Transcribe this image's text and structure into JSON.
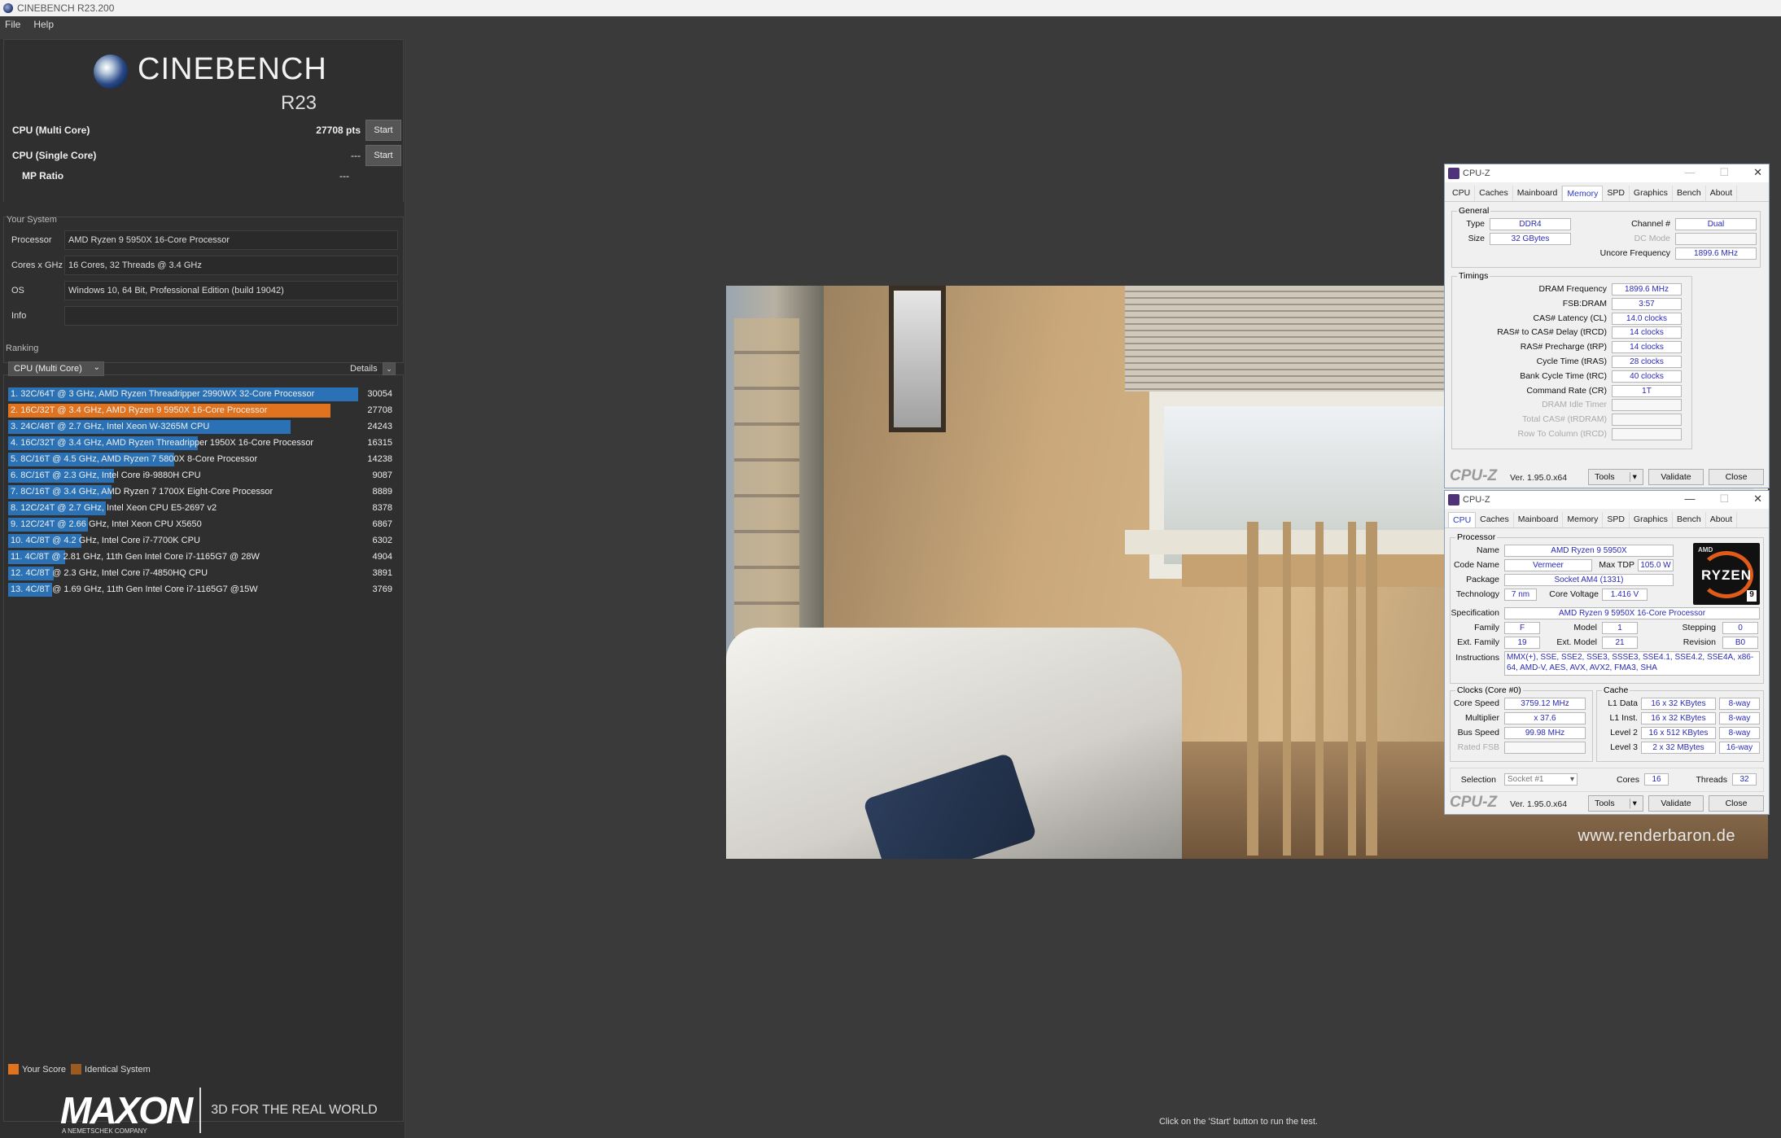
{
  "window": {
    "title": "CINEBENCH R23.200"
  },
  "menu": [
    "File",
    "Help"
  ],
  "logo": {
    "name": "CINEBENCH",
    "version": "R23"
  },
  "benchmarks": [
    {
      "label": "CPU (Multi Core)",
      "value": "27708 pts",
      "button": "Start"
    },
    {
      "label": "CPU (Single Core)",
      "value": "---",
      "button": "Start"
    },
    {
      "label": "MP Ratio",
      "value": "---"
    }
  ],
  "system": {
    "title": "Your System",
    "rows": [
      {
        "key": "Processor",
        "value": "AMD Ryzen 9 5950X 16-Core Processor"
      },
      {
        "key": "Cores x GHz",
        "value": "16 Cores, 32 Threads @ 3.4 GHz"
      },
      {
        "key": "OS",
        "value": "Windows 10, 64 Bit, Professional Edition (build 19042)"
      },
      {
        "key": "Info",
        "value": ""
      }
    ]
  },
  "ranking": {
    "title": "Ranking",
    "selected": "CPU (Multi Core)",
    "details_label": "Details",
    "max": 30054,
    "items": [
      {
        "label": "1. 32C/64T @ 3 GHz, AMD Ryzen Threadripper 2990WX 32-Core Processor",
        "score": 30054,
        "mine": false
      },
      {
        "label": "2. 16C/32T @ 3.4 GHz, AMD Ryzen 9 5950X 16-Core Processor",
        "score": 27708,
        "mine": true
      },
      {
        "label": "3. 24C/48T @ 2.7 GHz, Intel Xeon W-3265M CPU",
        "score": 24243,
        "mine": false
      },
      {
        "label": "4. 16C/32T @ 3.4 GHz, AMD Ryzen Threadripper 1950X 16-Core Processor",
        "score": 16315,
        "mine": false
      },
      {
        "label": "5. 8C/16T @ 4.5 GHz, AMD Ryzen 7 5800X 8-Core Processor",
        "score": 14238,
        "mine": false
      },
      {
        "label": "6. 8C/16T @ 2.3 GHz, Intel Core i9-9880H CPU",
        "score": 9087,
        "mine": false
      },
      {
        "label": "7. 8C/16T @ 3.4 GHz, AMD Ryzen 7 1700X Eight-Core Processor",
        "score": 8889,
        "mine": false
      },
      {
        "label": "8. 12C/24T @ 2.7 GHz, Intel Xeon CPU E5-2697 v2",
        "score": 8378,
        "mine": false
      },
      {
        "label": "9. 12C/24T @ 2.66 GHz, Intel Xeon CPU X5650",
        "score": 6867,
        "mine": false
      },
      {
        "label": "10. 4C/8T @ 4.2 GHz, Intel Core i7-7700K CPU",
        "score": 6302,
        "mine": false
      },
      {
        "label": "11. 4C/8T @ 2.81 GHz, 11th Gen Intel Core i7-1165G7 @ 28W",
        "score": 4904,
        "mine": false
      },
      {
        "label": "12. 4C/8T @ 2.3 GHz, Intel Core i7-4850HQ CPU",
        "score": 3891,
        "mine": false
      },
      {
        "label": "13. 4C/8T @ 1.69 GHz, 11th Gen Intel Core i7-1165G7 @15W",
        "score": 3769,
        "mine": false
      }
    ]
  },
  "legend": {
    "your_score": "Your Score",
    "identical": "Identical System"
  },
  "maxon": {
    "name": "MAXON",
    "sub": "A NEMETSCHEK COMPANY",
    "tagline": "3D FOR THE REAL WORLD"
  },
  "status": "Click on the 'Start' button to run the test.",
  "render": {
    "watermark": "www.renderbaron.de"
  },
  "cpuz_tabs": [
    "CPU",
    "Caches",
    "Mainboard",
    "Memory",
    "SPD",
    "Graphics",
    "Bench",
    "About"
  ],
  "cpuz_memory": {
    "title": "CPU-Z",
    "active_tab": "Memory",
    "general_title": "General",
    "type_label": "Type",
    "type": "DDR4",
    "size_label": "Size",
    "size": "32 GBytes",
    "channel_label": "Channel #",
    "channel": "Dual",
    "dcmode_label": "DC Mode",
    "dcmode": "",
    "uncore_label": "Uncore Frequency",
    "uncore": "1899.6 MHz",
    "timings_title": "Timings",
    "timings": [
      {
        "label": "DRAM Frequency",
        "value": "1899.6 MHz",
        "dim": false
      },
      {
        "label": "FSB:DRAM",
        "value": "3:57",
        "dim": false
      },
      {
        "label": "CAS# Latency (CL)",
        "value": "14.0 clocks",
        "dim": false
      },
      {
        "label": "RAS# to CAS# Delay (tRCD)",
        "value": "14 clocks",
        "dim": false
      },
      {
        "label": "RAS# Precharge (tRP)",
        "value": "14 clocks",
        "dim": false
      },
      {
        "label": "Cycle Time (tRAS)",
        "value": "28 clocks",
        "dim": false
      },
      {
        "label": "Bank Cycle Time (tRC)",
        "value": "40 clocks",
        "dim": false
      },
      {
        "label": "Command Rate (CR)",
        "value": "1T",
        "dim": false
      },
      {
        "label": "DRAM Idle Timer",
        "value": "",
        "dim": true
      },
      {
        "label": "Total CAS# (tRDRAM)",
        "value": "",
        "dim": true
      },
      {
        "label": "Row To Column (tRCD)",
        "value": "",
        "dim": true
      }
    ],
    "footer": {
      "brand": "CPU-Z",
      "version": "Ver. 1.95.0.x64",
      "tools": "Tools",
      "validate": "Validate",
      "close": "Close"
    }
  },
  "cpuz_cpu": {
    "title": "CPU-Z",
    "active_tab": "CPU",
    "processor_title": "Processor",
    "name_label": "Name",
    "name": "AMD Ryzen 9 5950X",
    "codename_label": "Code Name",
    "codename": "Vermeer",
    "maxtdp_label": "Max TDP",
    "maxtdp": "105.0 W",
    "package_label": "Package",
    "package": "Socket AM4 (1331)",
    "technology_label": "Technology",
    "technology": "7 nm",
    "voltage_label": "Core Voltage",
    "voltage": "1.416 V",
    "spec_label": "Specification",
    "spec": "AMD Ryzen 9 5950X 16-Core Processor",
    "family_label": "Family",
    "family": "F",
    "model_label": "Model",
    "model": "1",
    "stepping_label": "Stepping",
    "stepping": "0",
    "extfamily_label": "Ext. Family",
    "extfamily": "19",
    "extmodel_label": "Ext. Model",
    "extmodel": "21",
    "revision_label": "Revision",
    "revision": "B0",
    "instructions_label": "Instructions",
    "instructions": "MMX(+), SSE, SSE2, SSE3, SSSE3, SSE4.1, SSE4.2, SSE4A, x86-64, AMD-V, AES, AVX, AVX2, FMA3, SHA",
    "clocks_title": "Clocks (Core #0)",
    "corespeed_label": "Core Speed",
    "corespeed": "3759.12 MHz",
    "multiplier_label": "Multiplier",
    "multiplier": "x 37.6",
    "busspeed_label": "Bus Speed",
    "busspeed": "99.98 MHz",
    "ratedfsb_label": "Rated FSB",
    "ratedfsb": "",
    "cache_title": "Cache",
    "cache": [
      {
        "label": "L1 Data",
        "size": "16 x 32 KBytes",
        "way": "8-way"
      },
      {
        "label": "L1 Inst.",
        "size": "16 x 32 KBytes",
        "way": "8-way"
      },
      {
        "label": "Level 2",
        "size": "16 x 512 KBytes",
        "way": "8-way"
      },
      {
        "label": "Level 3",
        "size": "2 x 32 MBytes",
        "way": "16-way"
      }
    ],
    "selection_label": "Selection",
    "selection": "Socket #1",
    "cores_label": "Cores",
    "cores": "16",
    "threads_label": "Threads",
    "threads": "32",
    "logo": {
      "brand": "AMD",
      "word": "RYZEN",
      "tier": "9"
    },
    "footer": {
      "brand": "CPU-Z",
      "version": "Ver. 1.95.0.x64",
      "tools": "Tools",
      "validate": "Validate",
      "close": "Close"
    }
  }
}
